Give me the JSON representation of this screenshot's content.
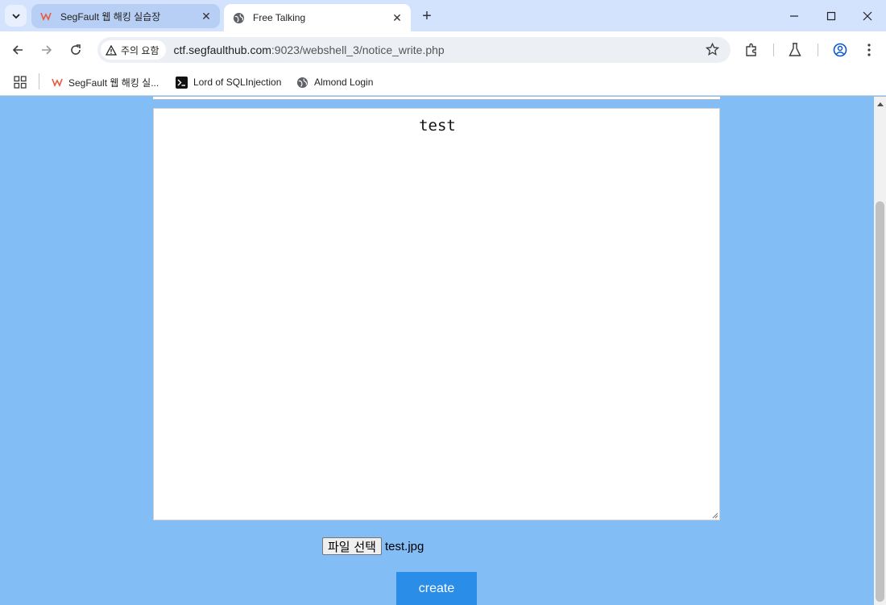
{
  "tabs": [
    {
      "title": "SegFault 웹 해킹 실습장",
      "active": false
    },
    {
      "title": "Free Talking",
      "active": true
    }
  ],
  "toolbar": {
    "security_chip": "주의 요함",
    "url_host": "ctf.segfaulthub.com",
    "url_rest": ":9023/webshell_3/notice_write.php"
  },
  "bookmarks": [
    {
      "label": "SegFault 웹 해킹 실..."
    },
    {
      "label": "Lord of SQLInjection"
    },
    {
      "label": "Almond Login"
    }
  ],
  "editor": {
    "content": "test"
  },
  "file": {
    "button_label": "파일 선택",
    "filename": "test.jpg"
  },
  "submit": {
    "label": "create"
  },
  "colors": {
    "page_bg": "#83bdf5",
    "create_button": "#2a8ee8",
    "tab_strip": "#d3e3fd"
  }
}
